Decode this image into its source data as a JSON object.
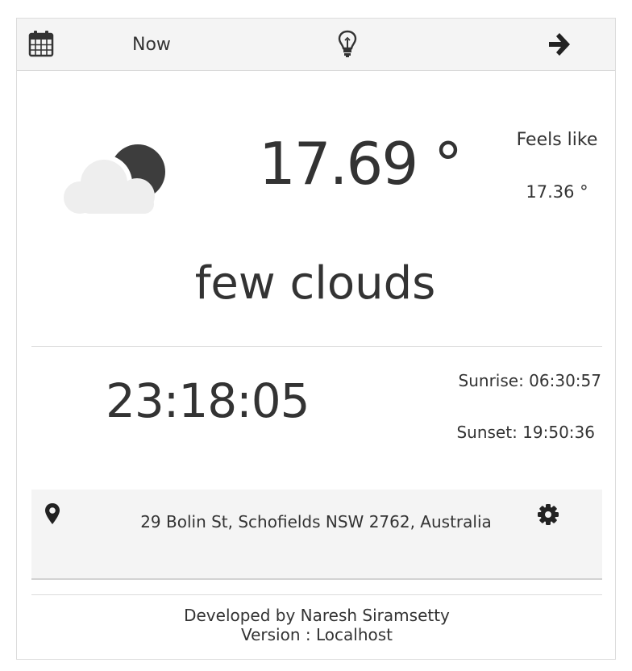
{
  "header": {
    "calendar_icon": "calendar-icon",
    "now_label": "Now",
    "bulb_icon": "lightbulb-icon",
    "arrow_icon": "arrow-right-icon"
  },
  "weather": {
    "icon": "few-clouds-night-icon",
    "temperature": "17.69 °",
    "feels_like_label": "Feels like",
    "feels_like_value": "17.36 °",
    "description": "few clouds"
  },
  "time": {
    "current": "23:18:05",
    "sunrise": "Sunrise:  06:30:57",
    "sunset": "Sunset:  19:50:36"
  },
  "location": {
    "pin_icon": "map-pin-icon",
    "address": "29 Bolin St, Schofields NSW 2762, Australia",
    "settings_icon": "gear-icon"
  },
  "footer": {
    "developer": "Developed by Naresh Siramsetty",
    "version": "Version : Localhost"
  },
  "colors": {
    "bar_bg": "#f4f4f4",
    "text": "#333333",
    "cloud": "#eeeeee",
    "moon": "#3d3d3d"
  }
}
